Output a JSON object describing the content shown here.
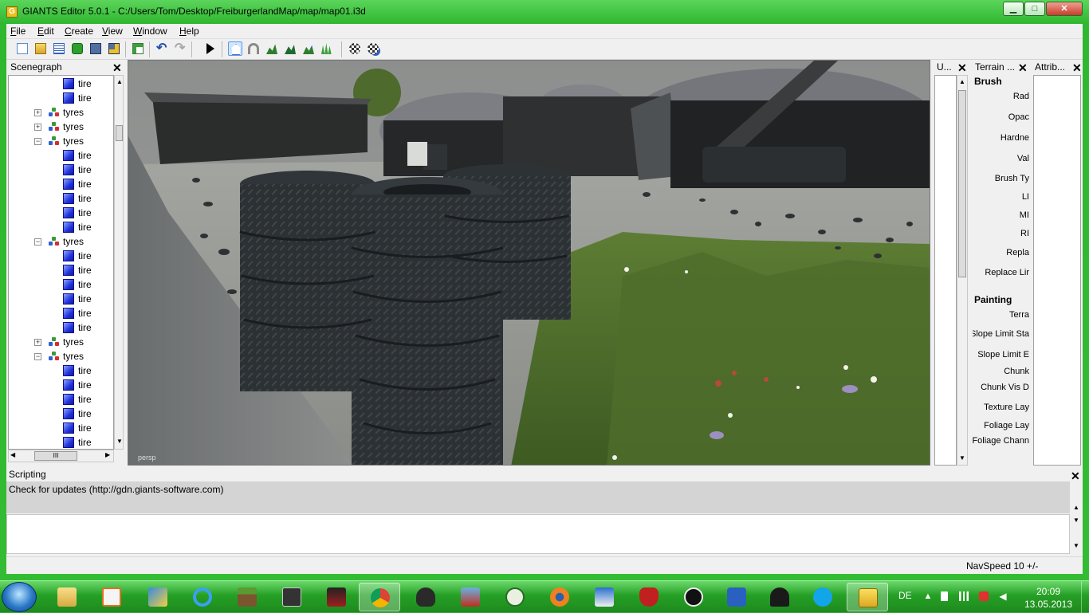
{
  "window": {
    "title": "GIANTS Editor 5.0.1 - C:/Users/Tom/Desktop/FreiburgerlandMap/map/map01.i3d",
    "app_icon_letter": "G",
    "min_glyph": "▁",
    "max_glyph": "□",
    "close_glyph": "✕"
  },
  "menu": [
    "File",
    "Edit",
    "Create",
    "View",
    "Window",
    "Help"
  ],
  "toolbar": {
    "buttons": [
      "new-icon",
      "open-icon",
      "list-icon",
      "refresh-icon",
      "save-icon",
      "save-as-icon",
      "import-icon",
      "undo-icon",
      "redo-icon",
      "play-icon",
      "home-icon",
      "magnet-icon",
      "terrain-sculpt-icon",
      "terrain-paint-icon",
      "foliage-icon",
      "grass-icon",
      "select-tool-icon",
      "transform-tool-icon"
    ]
  },
  "scenegraph": {
    "title": "Scenegraph",
    "close": "✕",
    "rows": [
      {
        "label": "tire",
        "type": "shape",
        "indent": 1
      },
      {
        "label": "tire",
        "type": "shape",
        "indent": 1
      },
      {
        "label": "tyres",
        "type": "group",
        "state": "collapsed"
      },
      {
        "label": "tyres",
        "type": "group",
        "state": "collapsed"
      },
      {
        "label": "tyres",
        "type": "group",
        "state": "expanded"
      },
      {
        "label": "tire",
        "type": "shape",
        "indent": 1
      },
      {
        "label": "tire",
        "type": "shape",
        "indent": 1
      },
      {
        "label": "tire",
        "type": "shape",
        "indent": 1
      },
      {
        "label": "tire",
        "type": "shape",
        "indent": 1
      },
      {
        "label": "tire",
        "type": "shape",
        "indent": 1
      },
      {
        "label": "tire",
        "type": "shape",
        "indent": 1
      },
      {
        "label": "tyres",
        "type": "group",
        "state": "expanded"
      },
      {
        "label": "tire",
        "type": "shape",
        "indent": 1
      },
      {
        "label": "tire",
        "type": "shape",
        "indent": 1
      },
      {
        "label": "tire",
        "type": "shape",
        "indent": 1
      },
      {
        "label": "tire",
        "type": "shape",
        "indent": 1
      },
      {
        "label": "tire",
        "type": "shape",
        "indent": 1
      },
      {
        "label": "tire",
        "type": "shape",
        "indent": 1
      },
      {
        "label": "tyres",
        "type": "group",
        "state": "collapsed"
      },
      {
        "label": "tyres",
        "type": "group",
        "state": "expanded"
      },
      {
        "label": "tire",
        "type": "shape",
        "indent": 1
      },
      {
        "label": "tire",
        "type": "shape",
        "indent": 1
      },
      {
        "label": "tire",
        "type": "shape",
        "indent": 1
      },
      {
        "label": "tire",
        "type": "shape",
        "indent": 1
      },
      {
        "label": "tire",
        "type": "shape",
        "indent": 1
      },
      {
        "label": "tire",
        "type": "shape",
        "indent": 1
      }
    ],
    "hscroll_grip": "III"
  },
  "viewport": {
    "camera_label": "persp"
  },
  "user_panel": {
    "title": "U...",
    "close": "✕"
  },
  "terrain_panel": {
    "title": "Terrain ...",
    "close": "✕",
    "brush_heading": "Brush",
    "brush_fields": [
      "Rad",
      "Opac",
      "Hardne",
      "Val",
      "Brush Ty",
      "LI",
      "MI",
      "RI",
      "Repla",
      "Replace Lir"
    ],
    "painting_heading": "Painting",
    "painting_fields": [
      "Terra",
      "Slope Limit Sta",
      "Slope Limit E",
      "Chunk",
      "Chunk Vis D",
      "Texture Lay",
      "Foliage Lay",
      "Foliage Chann"
    ]
  },
  "attrib_panel": {
    "title": "Attrib...",
    "close": "✕"
  },
  "scripting": {
    "title": "Scripting",
    "close": "✕",
    "log": "Check for updates (http://gdn.giants-software.com)"
  },
  "status": {
    "navspeed": "NavSpeed 10 +/-"
  },
  "taskbar": {
    "apps": [
      "explorer-icon",
      "media-player-icon",
      "paint-brush-icon",
      "ie-icon",
      "minecraft-icon",
      "game-99-icon",
      "em-2012-icon",
      "chrome-icon",
      "tractor-icon",
      "farming-simulator-icon",
      "steam-like-icon",
      "blender-icon",
      "sonic-icon",
      "red-tractor-icon",
      "origin-2-icon",
      "messenger-icon",
      "inkscape-icon",
      "skype-icon",
      "giants-editor-icon"
    ],
    "active_app": "giants-editor-icon",
    "highlighted_app": "chrome-icon",
    "language": "DE",
    "time": "20:09",
    "date": "13.05.2013"
  },
  "colors": {
    "window_frame": "#34bb34",
    "taskbar": "#26a026",
    "cube": "#2233dd",
    "grass": "#4d6a2b"
  }
}
